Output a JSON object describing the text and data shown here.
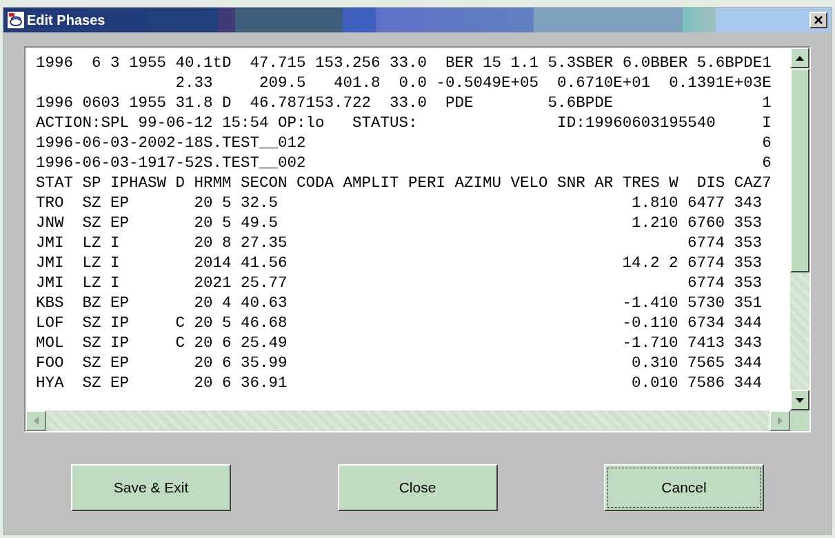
{
  "window": {
    "title": "Edit Phases"
  },
  "text_area": {
    "header_lines": [
      "1996  6 3 1955 40.1tD  47.715 153.256 33.0  BER 15 1.1 5.3SBER 6.0BBER 5.6BPDE1",
      "               2.33     209.5   401.8  0.0 -0.5049E+05  0.6710E+01  0.1391E+03E",
      "1996 0603 1955 31.8 D  46.787153.722  33.0  PDE        5.6BPDE                1",
      "ACTION:SPL 99-06-12 15:54 OP:lo   STATUS:               ID:19960603195540     I",
      "1996-06-03-2002-18S.TEST__012                                                 6",
      "1996-06-03-1917-52S.TEST__002                                                 6"
    ],
    "column_header": "STAT SP IPHASW D HRMM SECON CODA AMPLIT PERI AZIMU VELO SNR AR TRES W  DIS CAZ7",
    "rows": [
      {
        "stat": "TRO",
        "sp": "SZ",
        "iphase": "EP",
        "d": "",
        "hrmm": "20 5",
        "secon": "32.5",
        "tres_w": "1.810",
        "dis": "6477",
        "caz": "343"
      },
      {
        "stat": "JNW",
        "sp": "SZ",
        "iphase": "EP",
        "d": "",
        "hrmm": "20 5",
        "secon": "49.5",
        "tres_w": "1.210",
        "dis": "6760",
        "caz": "353"
      },
      {
        "stat": "JMI",
        "sp": "LZ",
        "iphase": "I",
        "d": "",
        "hrmm": "20 8",
        "secon": "27.35",
        "tres_w": "",
        "dis": "6774",
        "caz": "353"
      },
      {
        "stat": "JMI",
        "sp": "LZ",
        "iphase": "I",
        "d": "",
        "hrmm": "2014",
        "secon": "41.56",
        "tres_w": "14.2 2",
        "dis": "6774",
        "caz": "353"
      },
      {
        "stat": "JMI",
        "sp": "LZ",
        "iphase": "I",
        "d": "",
        "hrmm": "2021",
        "secon": "25.77",
        "tres_w": "",
        "dis": "6774",
        "caz": "353"
      },
      {
        "stat": "KBS",
        "sp": "BZ",
        "iphase": "EP",
        "d": "",
        "hrmm": "20 4",
        "secon": "40.63",
        "tres_w": "-1.410",
        "dis": "5730",
        "caz": "351"
      },
      {
        "stat": "LOF",
        "sp": "SZ",
        "iphase": "IP",
        "d": "C",
        "hrmm": "20 5",
        "secon": "46.68",
        "tres_w": "-0.110",
        "dis": "6734",
        "caz": "344"
      },
      {
        "stat": "MOL",
        "sp": "SZ",
        "iphase": "IP",
        "d": "C",
        "hrmm": "20 6",
        "secon": "25.49",
        "tres_w": "-1.710",
        "dis": "7413",
        "caz": "343"
      },
      {
        "stat": "FOO",
        "sp": "SZ",
        "iphase": "EP",
        "d": "",
        "hrmm": "20 6",
        "secon": "35.99",
        "tres_w": "0.310",
        "dis": "7565",
        "caz": "344"
      },
      {
        "stat": "HYA",
        "sp": "SZ",
        "iphase": "EP",
        "d": "",
        "hrmm": "20 6",
        "secon": "36.91",
        "tres_w": "0.010",
        "dis": "7586",
        "caz": "344"
      }
    ]
  },
  "buttons": [
    {
      "label": "Save & Exit",
      "focused": false
    },
    {
      "label": "Close",
      "focused": false
    },
    {
      "label": "Cancel",
      "focused": true
    }
  ]
}
